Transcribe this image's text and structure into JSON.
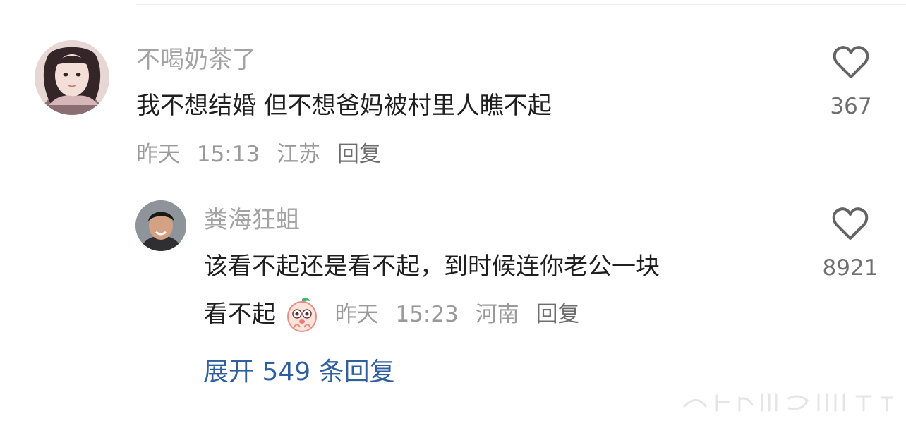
{
  "thread": {
    "expand_label": "展开 549 条回复"
  },
  "comments": [
    {
      "username": "不喝奶茶了",
      "text": "我不想结婚 但不想爸妈被村里人瞧不起",
      "date": "昨天",
      "time": "15:13",
      "location": "江苏",
      "reply_label": "回复",
      "likes": "367"
    },
    {
      "username": "粪海狂蛆",
      "text_line1": "该看不起还是看不起，到时候连你老公一块",
      "text_line2": "看不起",
      "date": "昨天",
      "time": "15:23",
      "location": "河南",
      "reply_label": "回复",
      "likes": "8921"
    }
  ],
  "icons": {
    "like": "heart-outline-icon",
    "emoji": "peach-face-emoji-icon"
  },
  "colors": {
    "username": "#a3a3a3",
    "text": "#1f1f1f",
    "meta": "#9a9a9a",
    "expand_link": "#2f5f9f"
  }
}
